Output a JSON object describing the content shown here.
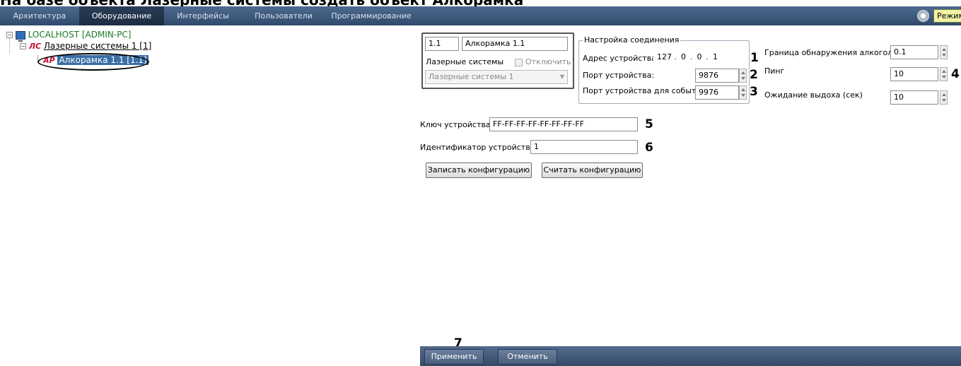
{
  "heading": "На базе объекта Лазерные системы создать объект Алкорамка",
  "menu": {
    "items": [
      "Архитектура",
      "Оборудование",
      "Интерфейсы",
      "Пользователи",
      "Программирование"
    ],
    "active_index": 1,
    "mode_label": "Режим: Дем"
  },
  "tree": {
    "root_label": "LOCALHOST [ADMIN-PC]",
    "ls_icon": "ЛС",
    "ls_label": "Лазерные системы 1 [1]",
    "ap_icon": "АР",
    "ap_label": "Алкорамка 1.1 [1.1]"
  },
  "device": {
    "id": "1.1",
    "name": "Алкорамка 1.1",
    "parent_label": "Лазерные системы",
    "disable_label": "Отключить",
    "parent_value": "Лазерные системы 1"
  },
  "connection": {
    "title": "Настройка соединения",
    "address_label": "Адрес устройства:",
    "ip": [
      "127",
      "0",
      "0",
      "1"
    ],
    "port_label": "Порт устройства:",
    "port_value": "9876",
    "event_port_label": "Порт устройства для событий:",
    "event_port_value": "9976"
  },
  "settings": {
    "threshold_label": "Граница обнаружения алкоголя, %",
    "threshold_value": "0.1",
    "ping_label": "Пинг",
    "ping_value": "10",
    "exhale_label": "Ожидание выдоха (сек)",
    "exhale_value": "10"
  },
  "key": {
    "label": "Ключ устройства:",
    "value": "FF-FF-FF-FF-FF-FF-FF-FF"
  },
  "identifier": {
    "label": "Идентификатор устройства:",
    "value": "1"
  },
  "buttons": {
    "write_config": "Записать конфигурацию",
    "read_config": "Считать конфигурацию",
    "apply": "Применить",
    "cancel": "Отменить"
  },
  "callouts": [
    "1",
    "2",
    "3",
    "4",
    "5",
    "6",
    "7"
  ]
}
